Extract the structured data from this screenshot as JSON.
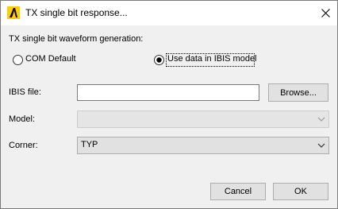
{
  "window": {
    "title": "TX single bit response..."
  },
  "group": {
    "label": "TX single bit waveform generation:",
    "options": [
      {
        "label": "COM Default",
        "selected": false
      },
      {
        "label": "Use data in IBIS model",
        "selected": true
      }
    ]
  },
  "ibis_file": {
    "label": "IBIS file:",
    "value": "",
    "browse_label": "Browse..."
  },
  "model": {
    "label": "Model:",
    "value": "",
    "enabled": false
  },
  "corner": {
    "label": "Corner:",
    "value": "TYP",
    "enabled": true
  },
  "footer": {
    "cancel_label": "Cancel",
    "ok_label": "OK"
  }
}
